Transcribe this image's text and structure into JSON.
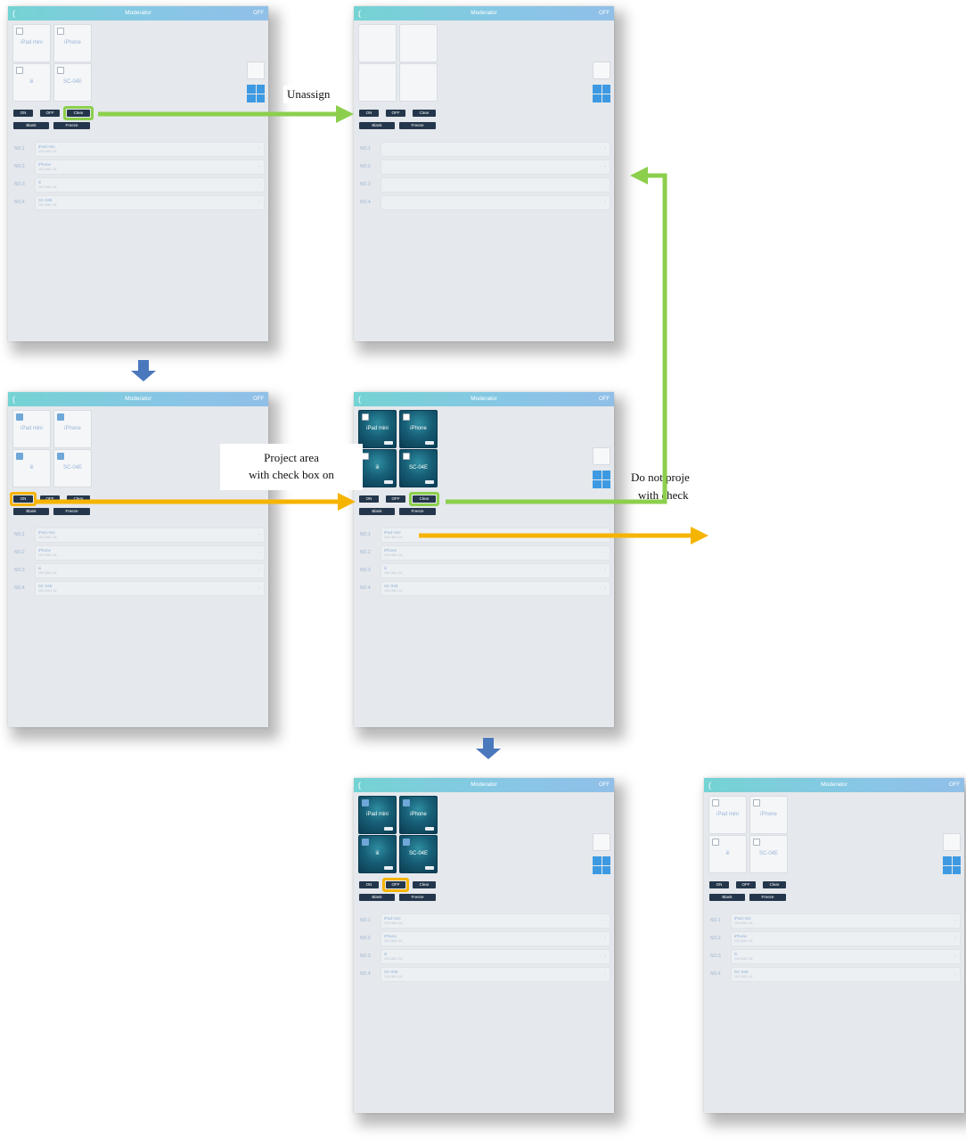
{
  "screens": [
    {
      "id": "s1",
      "title": "Moderator",
      "back": "(",
      "status": "OFF",
      "tiles": [
        {
          "label": "iPad mini",
          "checked": false,
          "active": false
        },
        {
          "label": "iPhone",
          "checked": false,
          "active": false
        },
        {
          "label": "iii",
          "checked": false,
          "active": false
        },
        {
          "label": "SC-04E",
          "checked": false,
          "active": false
        }
      ],
      "buttons": {
        "on": "ON",
        "off": "OFF",
        "clear": "Clear",
        "blank": "Blank",
        "freeze": "Freeze"
      },
      "rows": [
        {
          "no": "NO.1",
          "name": "iPad mini",
          "ip": "192.168.1.16"
        },
        {
          "no": "NO.2",
          "name": "iPhone",
          "ip": "192.168.1.16"
        },
        {
          "no": "NO.3",
          "name": "iii",
          "ip": "192.168.1.16"
        },
        {
          "no": "NO.4",
          "name": "SC-04E",
          "ip": "192.168.1.16"
        }
      ]
    },
    {
      "id": "s2",
      "title": "Moderator",
      "back": "(",
      "status": "OFF",
      "tiles": [
        {
          "label": "",
          "checked": null,
          "active": false
        },
        {
          "label": "",
          "checked": null,
          "active": false
        },
        {
          "label": "",
          "checked": null,
          "active": false
        },
        {
          "label": "",
          "checked": null,
          "active": false
        }
      ],
      "buttons": {
        "on": "ON",
        "off": "OFF",
        "clear": "Clear",
        "blank": "Blank",
        "freeze": "Freeze"
      },
      "rows": [
        {
          "no": "NO.1",
          "name": "",
          "ip": ""
        },
        {
          "no": "NO.2",
          "name": "",
          "ip": ""
        },
        {
          "no": "NO.3",
          "name": "",
          "ip": ""
        },
        {
          "no": "NO.4",
          "name": "",
          "ip": ""
        }
      ]
    },
    {
      "id": "s3",
      "title": "Moderator",
      "back": "(",
      "status": "OFF",
      "tiles": [
        {
          "label": "iPad mini",
          "checked": true,
          "active": false
        },
        {
          "label": "iPhone",
          "checked": true,
          "active": false
        },
        {
          "label": "iii",
          "checked": true,
          "active": false
        },
        {
          "label": "SC-04E",
          "checked": true,
          "active": false
        }
      ],
      "buttons": {
        "on": "ON",
        "off": "OFF",
        "clear": "Clear",
        "blank": "Blank",
        "freeze": "Freeze"
      },
      "rows": [
        {
          "no": "NO.1",
          "name": "iPad mini",
          "ip": "192.168.1.16"
        },
        {
          "no": "NO.2",
          "name": "iPhone",
          "ip": "192.168.1.16"
        },
        {
          "no": "NO.3",
          "name": "iii",
          "ip": "192.168.1.16"
        },
        {
          "no": "NO.4",
          "name": "SC-04E",
          "ip": "192.168.1.16"
        }
      ]
    },
    {
      "id": "s4",
      "title": "Moderator",
      "back": "(",
      "status": "OFF",
      "tiles": [
        {
          "label": "iPad mini",
          "checked": false,
          "active": true
        },
        {
          "label": "iPhone",
          "checked": false,
          "active": true
        },
        {
          "label": "iii",
          "checked": false,
          "active": true
        },
        {
          "label": "SC-04E",
          "checked": false,
          "active": true
        }
      ],
      "buttons": {
        "on": "ON",
        "off": "OFF",
        "clear": "Clear",
        "blank": "Blank",
        "freeze": "Freeze"
      },
      "rows": [
        {
          "no": "NO.1",
          "name": "iPad mini",
          "ip": "192.168.1.16"
        },
        {
          "no": "NO.2",
          "name": "iPhone",
          "ip": "192.168.1.16"
        },
        {
          "no": "NO.3",
          "name": "iii",
          "ip": "192.168.1.16"
        },
        {
          "no": "NO.4",
          "name": "SC-04E",
          "ip": "192.168.1.16"
        }
      ]
    },
    {
      "id": "s5",
      "title": "Moderator",
      "back": "(",
      "status": "OFF",
      "tiles": [
        {
          "label": "iPad mini",
          "checked": true,
          "active": true
        },
        {
          "label": "iPhone",
          "checked": true,
          "active": true
        },
        {
          "label": "iii",
          "checked": true,
          "active": true
        },
        {
          "label": "SC-04E",
          "checked": true,
          "active": true
        }
      ],
      "buttons": {
        "on": "ON",
        "off": "OFF",
        "clear": "Clear",
        "blank": "Blank",
        "freeze": "Freeze"
      },
      "rows": [
        {
          "no": "NO.1",
          "name": "iPad mini",
          "ip": "192.168.1.16"
        },
        {
          "no": "NO.2",
          "name": "iPhone",
          "ip": "192.168.1.16"
        },
        {
          "no": "NO.3",
          "name": "iii",
          "ip": "192.168.1.16"
        },
        {
          "no": "NO.4",
          "name": "SC-04E",
          "ip": "192.168.1.16"
        }
      ]
    },
    {
      "id": "s6",
      "title": "Moderator",
      "back": "(",
      "status": "OFF",
      "tiles": [
        {
          "label": "iPad mini",
          "checked": false,
          "active": false
        },
        {
          "label": "iPhone",
          "checked": false,
          "active": false
        },
        {
          "label": "iii",
          "checked": false,
          "active": false
        },
        {
          "label": "SC-04E",
          "checked": false,
          "active": false
        }
      ],
      "buttons": {
        "on": "ON",
        "off": "OFF",
        "clear": "Clear",
        "blank": "Blank",
        "freeze": "Freeze"
      },
      "rows": [
        {
          "no": "NO.1",
          "name": "iPad mini",
          "ip": "192.168.1.16"
        },
        {
          "no": "NO.2",
          "name": "iPhone",
          "ip": "192.168.1.16"
        },
        {
          "no": "NO.3",
          "name": "iii",
          "ip": "192.168.1.16"
        },
        {
          "no": "NO.4",
          "name": "SC-04E",
          "ip": "192.168.1.16"
        }
      ]
    }
  ],
  "annotations": {
    "unassign": "Unassign",
    "project_line1": "Project area",
    "project_line2": "with check box on",
    "noproject_line1": "Do not proje",
    "noproject_line2": "with check"
  },
  "colors": {
    "header_gradient_start": "#74d3d3",
    "header_gradient_end": "#90bfe8",
    "button_dark": "#24364b",
    "arrow_green": "#8ccf4d",
    "arrow_orange": "#f5b400",
    "arrow_blue": "#4a78bd",
    "grid_blue": "#3d9ae2"
  }
}
